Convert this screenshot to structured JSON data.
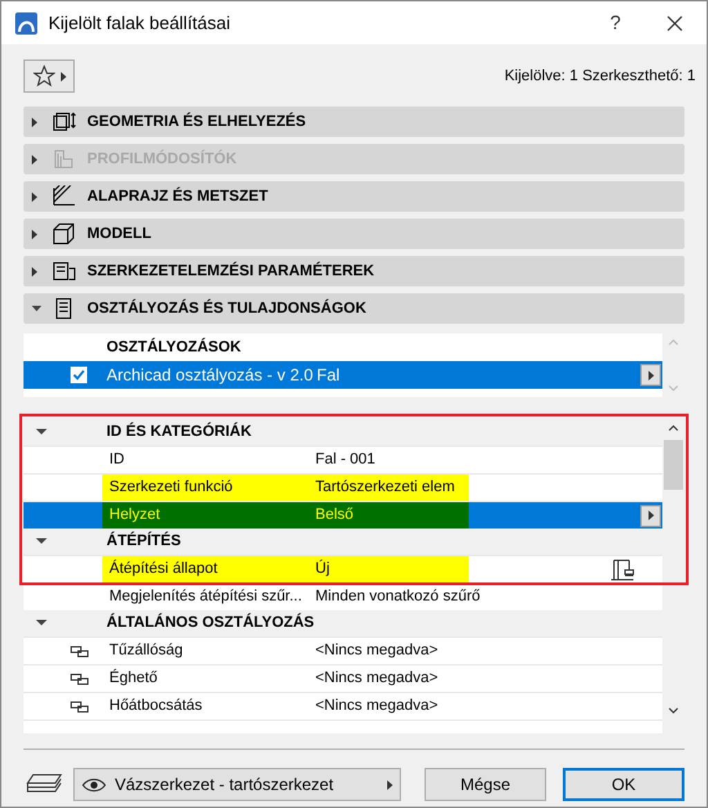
{
  "window": {
    "title": "Kijelölt falak beállításai",
    "help": "?"
  },
  "toolbar": {
    "selection_info": "Kijelölve: 1 Szerkeszthető: 1"
  },
  "sections": [
    {
      "label": "GEOMETRIA ÉS ELHELYEZÉS",
      "kind": "geometry",
      "expanded": false,
      "disabled": false
    },
    {
      "label": "PROFILMÓDOSÍTÓK",
      "kind": "profile",
      "expanded": false,
      "disabled": true
    },
    {
      "label": "ALAPRAJZ ÉS METSZET",
      "kind": "plan",
      "expanded": false,
      "disabled": false
    },
    {
      "label": "MODELL",
      "kind": "model",
      "expanded": false,
      "disabled": false
    },
    {
      "label": "SZERKEZETELEMZÉSI PARAMÉTEREK",
      "kind": "structural",
      "expanded": false,
      "disabled": false
    },
    {
      "label": "OSZTÁLYOZÁS ÉS TULAJDONSÁGOK",
      "kind": "classification",
      "expanded": true,
      "disabled": false
    }
  ],
  "classifications": {
    "heading": "OSZTÁLYOZÁSOK",
    "rows": [
      {
        "checked": true,
        "system": "Archicad osztályozás - v 2.0",
        "value": "Fal",
        "selected": true
      }
    ]
  },
  "properties": {
    "groups": [
      {
        "title": "ID ÉS KATEGÓRIÁK",
        "expanded": true,
        "framed": true,
        "rows": [
          {
            "kind": "plain",
            "label": "ID",
            "value": "Fal - 001",
            "selected": false,
            "highlighted": false
          },
          {
            "kind": "plain",
            "label": "Szerkezeti funkció",
            "value": "Tartószerkezeti elem",
            "selected": false,
            "highlighted": true
          },
          {
            "kind": "plain",
            "label": "Helyzet",
            "value": "Belső",
            "selected": true,
            "highlighted": true
          }
        ]
      },
      {
        "title": "ÁTÉPÍTÉS",
        "expanded": true,
        "framed": true,
        "rows": [
          {
            "kind": "renovation",
            "label": "Átépítési állapot",
            "value": "Új",
            "selected": false,
            "highlighted": true,
            "framed": true
          },
          {
            "kind": "plain",
            "label": "Megjelenítés átépítési szűr...",
            "value": "Minden vonatkozó szűrő",
            "selected": false,
            "highlighted": false,
            "framed": false
          }
        ]
      },
      {
        "title": "ÁLTALÁNOS OSZTÁLYOZÁS",
        "expanded": true,
        "framed": false,
        "rows": [
          {
            "kind": "linked",
            "label": "Tűzállóság",
            "value": "<Nincs megadva>",
            "selected": false,
            "highlighted": false
          },
          {
            "kind": "linked",
            "label": "Éghető",
            "value": "<Nincs megadva>",
            "selected": false,
            "highlighted": false
          },
          {
            "kind": "linked",
            "label": "Hőátbocsátás",
            "value": "<Nincs megadva>",
            "selected": false,
            "highlighted": false
          }
        ]
      }
    ]
  },
  "footer": {
    "layer": "Vázszerkezet - tartószerkezet",
    "buttons": [
      {
        "label": "Mégse",
        "default": false
      },
      {
        "label": "OK",
        "default": true
      }
    ]
  }
}
